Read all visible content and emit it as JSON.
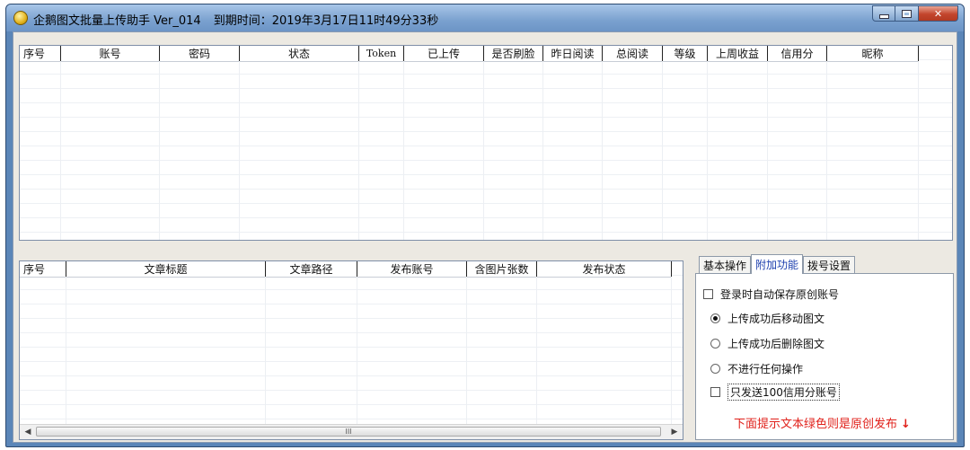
{
  "window": {
    "title": "企鹅图文批量上传助手 Ver_014",
    "expire_label": "到期时间：",
    "expire_time": "2019年3月17日11时49分33秒"
  },
  "accounts_table": {
    "columns": [
      "序号",
      "账号",
      "密码",
      "状态",
      "Token",
      "已上传",
      "是否刷脸",
      "昨日阅读",
      "总阅读",
      "等级",
      "上周收益",
      "信用分",
      "昵称"
    ],
    "rows": []
  },
  "articles_table": {
    "columns": [
      "序号",
      "文章标题",
      "文章路径",
      "发布账号",
      "含图片张数",
      "发布状态"
    ],
    "rows": []
  },
  "tabs": [
    "基本操作",
    "附加功能",
    "拨号设置"
  ],
  "active_tab": "附加功能",
  "options": {
    "auto_save_original": {
      "label": "登录时自动保存原创账号",
      "checked": false
    },
    "move_after_upload": {
      "label": "上传成功后移动图文",
      "selected": true
    },
    "delete_after_upload": {
      "label": "上传成功后删除图文",
      "selected": false
    },
    "no_action": {
      "label": "不进行任何操作",
      "selected": false
    },
    "only_100_credit": {
      "label": "只发送100信用分账号",
      "checked": false
    }
  },
  "hint": {
    "text": "下面提示文本绿色则是原创发布",
    "arrow": "↓",
    "color": "#e0201a"
  },
  "scrollbar": {
    "thumb_grip": "III"
  },
  "colors": {
    "titlebar": "#7aa1cf",
    "active_tab_text": "#1d3fae"
  }
}
